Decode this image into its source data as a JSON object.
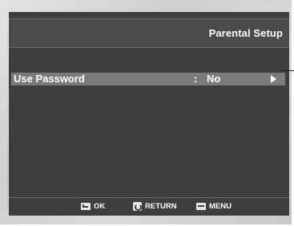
{
  "header": {
    "title": "Parental Setup"
  },
  "menu": {
    "items": [
      {
        "label": "Use Password",
        "separator": ":",
        "value": "No",
        "arrow_icon": "right-triangle-icon",
        "selected": true
      }
    ]
  },
  "footer": {
    "buttons": [
      {
        "icon": "enter-icon",
        "label": "OK"
      },
      {
        "icon": "return-icon",
        "label": "RETURN"
      },
      {
        "icon": "menu-icon",
        "label": "MENU"
      }
    ]
  },
  "colors": {
    "screen_background": "#3e3e3e",
    "title_bar": "#4b4b4b",
    "highlight_row": "#7b7b7b",
    "text": "#ffffff",
    "bezel": "#d4d4d4"
  }
}
